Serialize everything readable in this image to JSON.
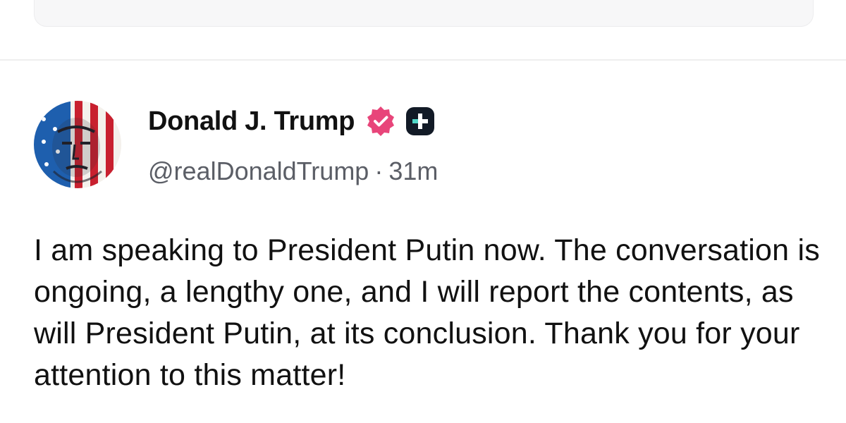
{
  "post": {
    "author": {
      "display_name": "Donald J. Trump",
      "handle": "@realDonaldTrump",
      "avatar_icon": "flag-portrait-avatar",
      "verified_icon": "verified-badge-icon",
      "verified_color": "#e8457a",
      "plus_icon": "plus-badge-icon"
    },
    "separator": "·",
    "timestamp": "31m",
    "text": "I am speaking to President Putin now. The conversation is ongoing, a lengthy one, and I will report the contents, as will President Putin, at its conclusion. Thank you for your attention to this matter!"
  }
}
